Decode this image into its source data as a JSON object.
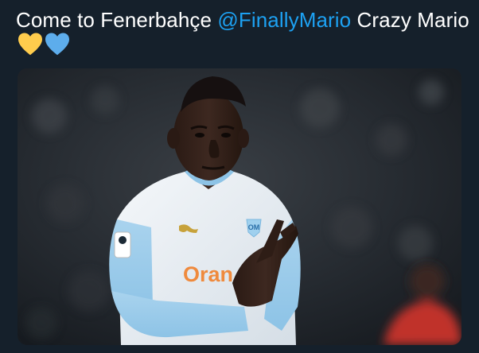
{
  "tweet": {
    "text_before": "Come to Fenerbahçe ",
    "mention": "@FinallyMario",
    "text_after": " Crazy Mario",
    "emoji": [
      {
        "icon": "yellow-heart-icon",
        "color": "#ffcc4d"
      },
      {
        "icon": "blue-heart-icon",
        "color": "#5dadec"
      }
    ]
  },
  "colors": {
    "background": "#15202b",
    "text": "#ffffff",
    "mention": "#1da1f2"
  },
  "media": {
    "jersey_sponsor": "Oran",
    "jersey_brand_mark": "puma-logo",
    "jersey_crest": "olympique-marseille-crest",
    "sleeve_patch": "ligue-1-patch"
  }
}
